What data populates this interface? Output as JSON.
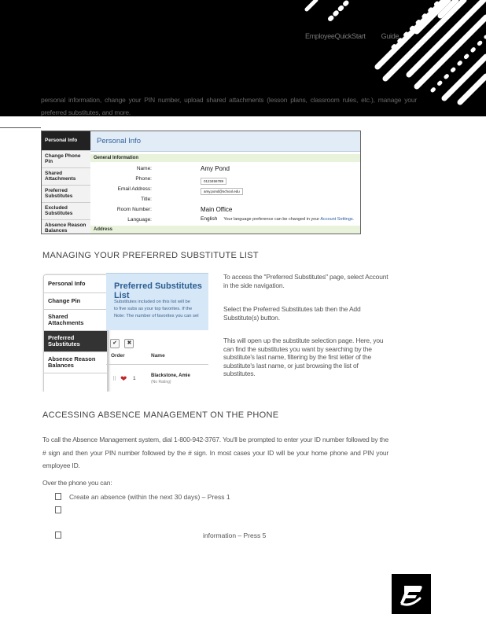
{
  "header": {
    "doc_title": "EmployeeQuickStart",
    "doc_title_suffix": "Guide",
    "intro_text": "personal information, change your PIN number, upload shared attachments (lesson plans, classroom rules, etc.), manage your preferred substitutes, and more."
  },
  "screenshot_personal": {
    "sidebar": [
      "Personal Info",
      "Change Phone Pin",
      "Shared Attachments",
      "Preferred Substitutes",
      "Excluded Substitutes",
      "Absence Reason Balances"
    ],
    "title": "Personal Info",
    "section": "General Information",
    "fields": {
      "name_label": "Name:",
      "name_value": "Amy Pond",
      "phone_label": "Phone:",
      "phone_value": "0123456789",
      "email_label": "Email Address:",
      "email_value": "amy.pond@school.edu",
      "title_label": "Title:",
      "title_value": "",
      "room_label": "Room Number:",
      "room_value": "Main Office",
      "lang_label": "Language:",
      "lang_value": "English",
      "lang_note": "Your language preference can be changed in your",
      "lang_link": "Account Settings."
    },
    "address_section": "Address"
  },
  "section_managing": "MANAGING YOUR PREFERRED SUBSTITUTE LIST",
  "screenshot_preferred": {
    "sidebar": [
      "Personal Info",
      "Change Pin",
      "Shared Attachments",
      "Preferred Substitutes",
      "Absence Reason Balances"
    ],
    "title": "Preferred Substitutes List",
    "desc_line1": "Substitutes included on this list will be",
    "desc_line2": "to five subs as your top favorites. If the",
    "desc_line3": "Note: The number of favorites you can sel",
    "btn_check": "✔",
    "btn_x": "✖",
    "col_order": "Order",
    "col_name": "Name",
    "row_rank": "1",
    "row_name": "Blackstone, Amie",
    "row_rating": "(No Rating)"
  },
  "paragraphs": {
    "p1": "To access the \"Preferred Substitutes\" page, select Account in the side navigation.",
    "p2": "Select the Preferred Substitutes tab then the Add Substitute(s) button.",
    "p3": "This will open up the substitute selection page. Here, you can find the substitutes you want by searching by the substitute's last name, filtering by the first letter of the substitute's last name, or just browsing the list of substitutes."
  },
  "section_accessing": "ACCESSING ABSENCE MANAGEMENT ON THE PHONE",
  "phone": {
    "text": "To call the Absence Management system, dial 1-800-942-3767. You'll be prompted to enter your ID number followed by the # sign and then your PIN number followed by the # sign. In most cases your ID will be your home phone and PIN your employee ID.",
    "over_text": "Over the phone you can:",
    "bullet1": "Create an absence (within the next 30 days) – Press 1",
    "bullet3": "information – Press 5"
  },
  "colors": {
    "header_bg": "#000000",
    "accent_blue": "#2b5d91",
    "heart_red": "#c0252b"
  }
}
